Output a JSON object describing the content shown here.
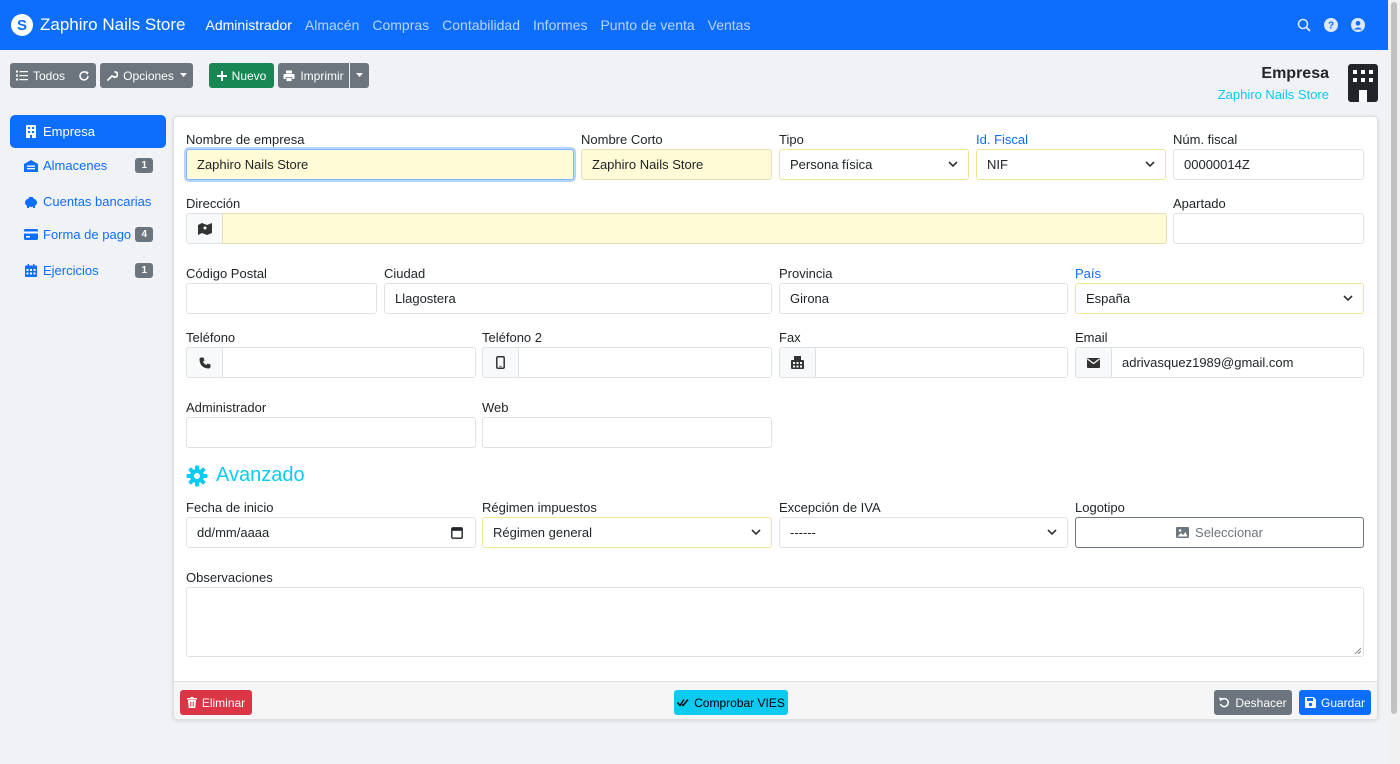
{
  "brand": {
    "name": "Zaphiro Nails Store"
  },
  "nav": {
    "items": [
      "Administrador",
      "Almacén",
      "Compras",
      "Contabilidad",
      "Informes",
      "Punto de venta",
      "Ventas"
    ]
  },
  "toolbar": {
    "todos": "Todos",
    "opciones": "Opciones",
    "nuevo": "Nuevo",
    "imprimir": "Imprimir"
  },
  "header": {
    "title": "Empresa",
    "subtitle": "Zaphiro Nails Store"
  },
  "sidebar": {
    "items": [
      {
        "label": "Empresa",
        "badge": ""
      },
      {
        "label": "Almacenes",
        "badge": "1"
      },
      {
        "label": "Cuentas bancarias",
        "badge": ""
      },
      {
        "label": "Forma de pago",
        "badge": "4"
      },
      {
        "label": "Ejercicios",
        "badge": "1"
      }
    ]
  },
  "form": {
    "nombre_label": "Nombre de empresa",
    "nombre_value": "Zaphiro Nails Store",
    "corto_label": "Nombre Corto",
    "corto_value": "Zaphiro Nails Store",
    "tipo_label": "Tipo",
    "tipo_value": "Persona física",
    "idfiscal_label": "Id. Fiscal",
    "idfiscal_value": "NIF",
    "numfiscal_label": "Núm. fiscal",
    "numfiscal_value": "00000014Z",
    "direccion_label": "Dirección",
    "direccion_value": "",
    "apartado_label": "Apartado",
    "apartado_value": "",
    "cp_label": "Código Postal",
    "cp_value": "",
    "ciudad_label": "Ciudad",
    "ciudad_value": "Llagostera",
    "provincia_label": "Provincia",
    "provincia_value": "Girona",
    "pais_label": "País",
    "pais_value": "España",
    "telefono_label": "Teléfono",
    "telefono_value": "",
    "telefono2_label": "Teléfono 2",
    "telefono2_value": "",
    "fax_label": "Fax",
    "fax_value": "",
    "email_label": "Email",
    "email_value": "adrivasquez1989@gmail.com",
    "admin_label": "Administrador",
    "admin_value": "",
    "web_label": "Web",
    "web_value": "",
    "avanzado_title": "Avanzado",
    "fecha_label": "Fecha de inicio",
    "fecha_placeholder": "dd/mm/aaaa",
    "regimen_label": "Régimen impuestos",
    "regimen_value": "Régimen general",
    "excepcion_label": "Excepción de IVA",
    "excepcion_value": "------",
    "logotipo_label": "Logotipo",
    "logotipo_button": "Seleccionar",
    "observaciones_label": "Observaciones",
    "observaciones_value": ""
  },
  "footer": {
    "eliminar": "Eliminar",
    "vies": "Comprobar VIES",
    "deshacer": "Deshacer",
    "guardar": "Guardar"
  },
  "colors": {
    "primary": "#0d6efd",
    "secondary": "#6c757d",
    "success": "#198754",
    "danger": "#dc3545",
    "info": "#0dcaf0",
    "required_bg": "#fffbd6"
  }
}
